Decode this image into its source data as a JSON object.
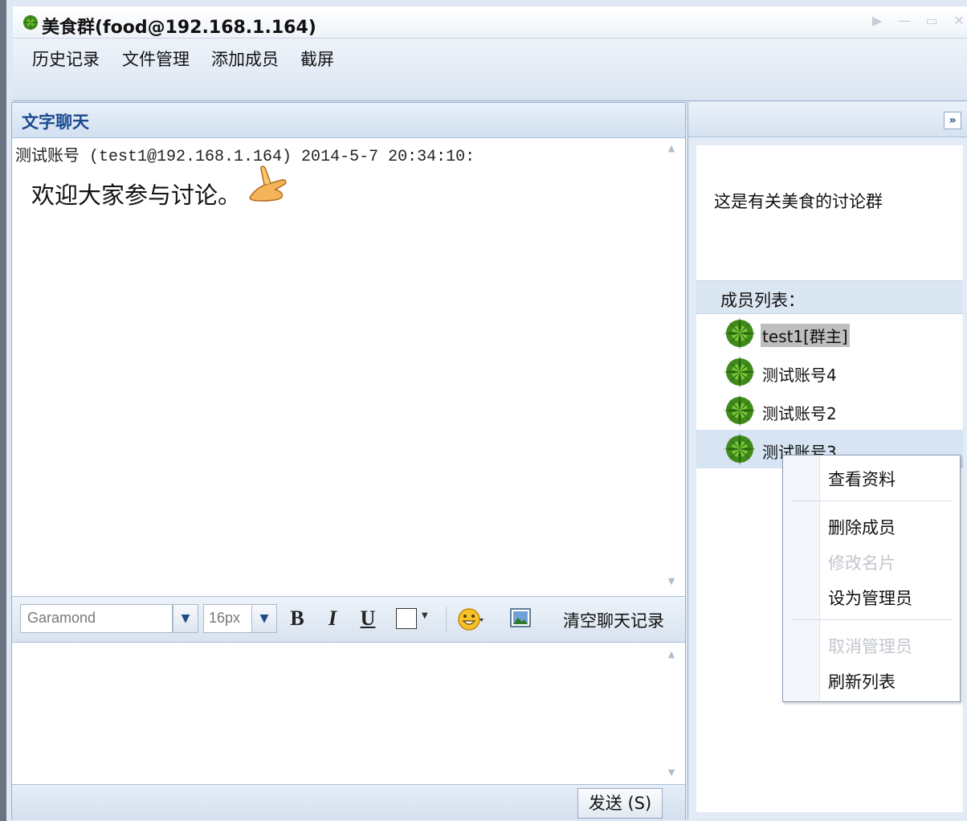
{
  "window": {
    "title": "美食群(food@192.168.1.164)",
    "controls": [
      "▶",
      "—",
      "▭",
      "✕"
    ]
  },
  "menu": {
    "items": [
      "历史记录",
      "文件管理",
      "添加成员",
      "截屏"
    ]
  },
  "chat": {
    "header": "文字聊天",
    "message": {
      "sender": "测试账号",
      "meta": "(test1@192.168.1.164) 2014-5-7 20:34:10:",
      "text": "欢迎大家参与讨论。"
    },
    "toolbar": {
      "font": "Garamond",
      "size": "16px",
      "bold": "B",
      "italic": "I",
      "underline": "U",
      "clear_label": "清空聊天记录"
    },
    "send_label": "发送 (S)"
  },
  "side": {
    "collapse_label": "»",
    "description": "这是有关美食的讨论群",
    "members_title": "成员列表：",
    "members": [
      "test1[群主]",
      "测试账号4",
      "测试账号2",
      "测试账号3"
    ]
  },
  "context_menu": {
    "items": [
      {
        "label": "查看资料",
        "disabled": false
      },
      {
        "label": "删除成员",
        "disabled": false
      },
      {
        "label": "修改名片",
        "disabled": true
      },
      {
        "label": "设为管理员",
        "disabled": false
      },
      {
        "label": "取消管理员",
        "disabled": true
      },
      {
        "label": "刷新列表",
        "disabled": false
      }
    ]
  },
  "colors": {
    "accent": "#1b4b8f",
    "panel_bg": "#dfe9f5",
    "avatar_green": "#3f8a1a"
  },
  "icons": {
    "title": "green-flower-icon",
    "emoji": "thumbs-hand-icon",
    "avatar": "green-flower-avatar-icon"
  }
}
